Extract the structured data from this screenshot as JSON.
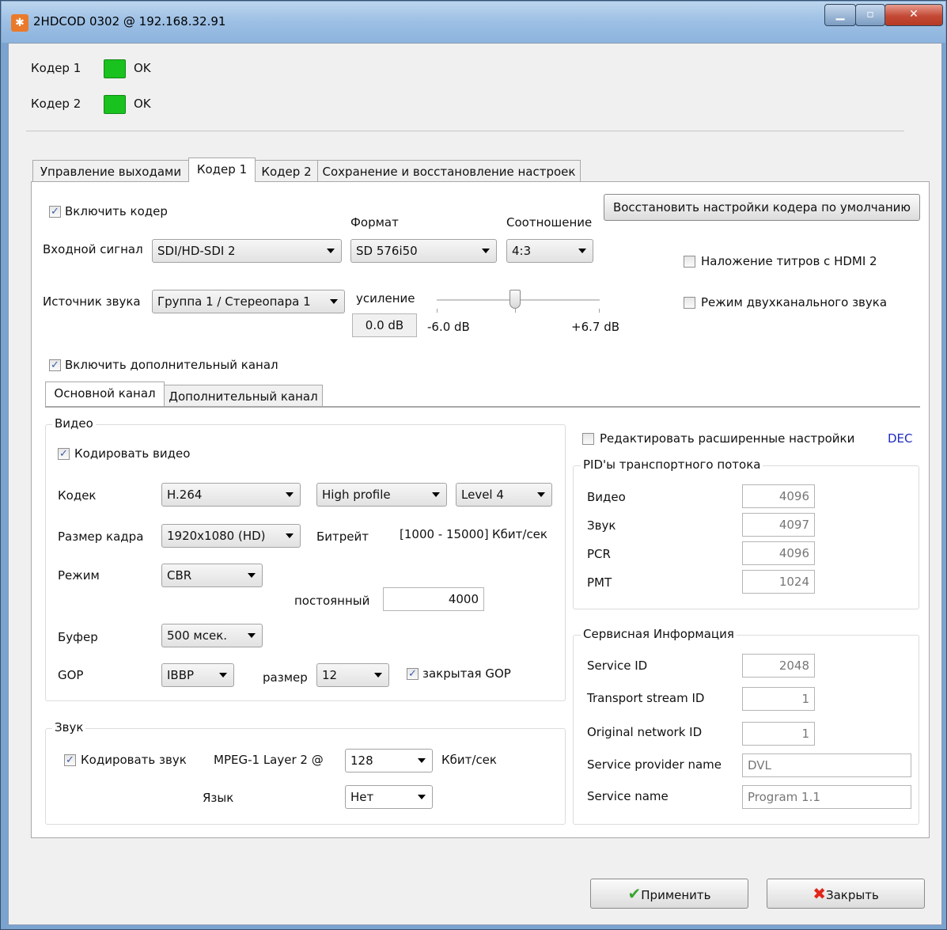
{
  "window": {
    "title": "2HDCOD 0302 @ 192.168.32.91",
    "accent": "#19c21e"
  },
  "status": [
    {
      "label": "Кодер 1",
      "value": "OK"
    },
    {
      "label": "Кодер 2",
      "value": "OK"
    }
  ],
  "tabs": [
    "Управление выходами",
    "Кодер 1",
    "Кодер 2",
    "Сохранение и восстановление настроек"
  ],
  "encoder": {
    "enable_label": "Включить кодер",
    "reset_button": "Восстановить настройки кодера по умолчанию",
    "format_label": "Формат",
    "ratio_label": "Соотношение",
    "input_label": "Входной сигнал",
    "input_value": "SDI/HD-SDI 2",
    "format_value": "SD 576i50",
    "ratio_value": "4:3",
    "hdmi_overlay_label": "Наложение титров с HDMI 2",
    "audio_source_label": "Источник звука",
    "audio_source_value": "Группа 1 / Стереопара 1",
    "gain_label": "усиление",
    "gain_value": "0.0 dB",
    "gain_min": "-6.0 dB",
    "gain_max": "+6.7 dB",
    "gain_level_fraction": 0.48,
    "dual_audio_label": "Режим двухканального звука",
    "extra_channel_label": "Включить дополнительный канал"
  },
  "subtabs": [
    "Основной канал",
    "Дополнительный канал"
  ],
  "video": {
    "group_title": "Видео",
    "encode_label": "Кодировать видео",
    "codec_label": "Кодек",
    "codec_value": "H.264",
    "profile_value": "High profile",
    "level_value": "Level 4",
    "frame_label": "Размер кадра",
    "frame_value": "1920x1080 (HD)",
    "bitrate_label": "Битрейт",
    "bitrate_range": "[1000 - 15000]",
    "bitrate_unit": "Кбит/сек",
    "mode_label": "Режим",
    "mode_value": "CBR",
    "constant_label": "постоянный",
    "constant_value": "4000",
    "buffer_label": "Буфер",
    "buffer_value": "500 мсек.",
    "gop_label": "GOP",
    "gop_value": "IBBP",
    "size_label": "размер",
    "size_value": "12",
    "closed_gop_label": "закрытая GOP"
  },
  "audio": {
    "group_title": "Звук",
    "encode_label": "Кодировать звук",
    "codec_label": "MPEG-1 Layer 2 @",
    "bitrate_value": "128",
    "bitrate_unit": "Кбит/сек",
    "lang_label": "Язык",
    "lang_value": "Нет"
  },
  "advanced": {
    "edit_label": "Редактировать расширенные настройки",
    "dec": "DEC"
  },
  "pids": {
    "group_title": "PID'ы транспортного потока",
    "rows": [
      {
        "label": "Видео",
        "value": "4096"
      },
      {
        "label": "Звук",
        "value": "4097"
      },
      {
        "label": "PCR",
        "value": "4096"
      },
      {
        "label": "PMT",
        "value": "1024"
      }
    ]
  },
  "service": {
    "group_title": "Сервисная Информация",
    "rows": [
      {
        "label": "Service ID",
        "value": "2048"
      },
      {
        "label": "Transport stream ID",
        "value": "1"
      },
      {
        "label": "Original network ID",
        "value": "1"
      },
      {
        "label": "Service provider name",
        "value": "DVL"
      },
      {
        "label": "Service name",
        "value": "Program 1.1"
      }
    ]
  },
  "footer": {
    "apply": "Применить",
    "close": "Закрыть"
  }
}
